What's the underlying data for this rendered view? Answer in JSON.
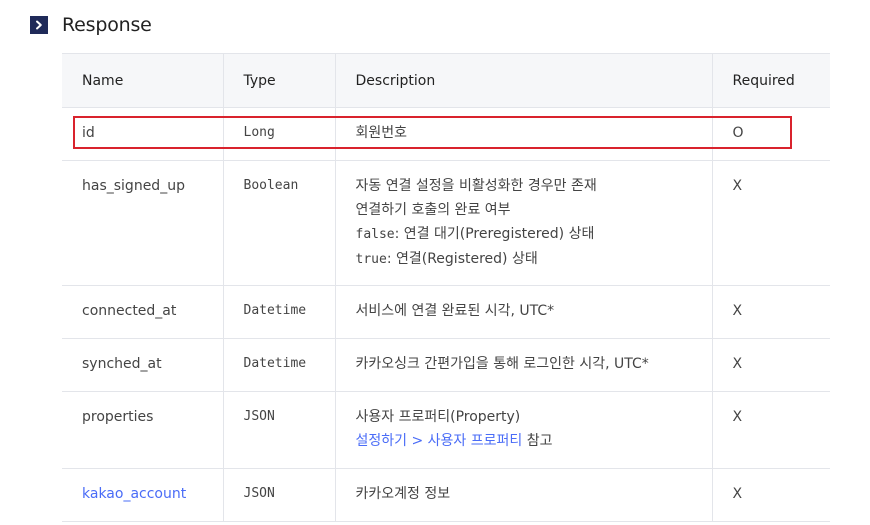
{
  "section": {
    "title": "Response",
    "icon": "chevron-right-icon",
    "accent_color": "#1f2a59"
  },
  "columns": [
    "Name",
    "Type",
    "Description",
    "Required"
  ],
  "rows": [
    {
      "name": "id",
      "type": "Long",
      "desc": [
        "회원번호"
      ],
      "required": "O",
      "highlighted": true
    },
    {
      "name": "has_signed_up",
      "type": "Boolean",
      "desc": [
        "자동 연결 설정을 비활성화한 경우만 존재",
        "연결하기 호출의 완료 여부"
      ],
      "desc_code": [
        {
          "code": "false",
          "text": ": 연결 대기(Preregistered) 상태"
        },
        {
          "code": "true",
          "text": ": 연결(Registered) 상태"
        }
      ],
      "required": "X"
    },
    {
      "name": "connected_at",
      "type": "Datetime",
      "desc": [
        "서비스에 연결 완료된 시각, UTC*"
      ],
      "required": "X"
    },
    {
      "name": "synched_at",
      "type": "Datetime",
      "desc": [
        "카카오싱크 간편가입을 통해 로그인한 시각, UTC*"
      ],
      "required": "X"
    },
    {
      "name": "properties",
      "type": "JSON",
      "desc": [
        "사용자 프로퍼티(Property)"
      ],
      "desc_link": {
        "link_text": "설정하기 > 사용자 프로퍼티",
        "suffix": " 참고"
      },
      "required": "X"
    },
    {
      "name": "kakao_account",
      "name_is_link": true,
      "type": "JSON",
      "desc": [
        "카카오계정 정보"
      ],
      "required": "X"
    }
  ],
  "colors": {
    "highlight": "#d9232d",
    "link": "#4a6cf7"
  }
}
